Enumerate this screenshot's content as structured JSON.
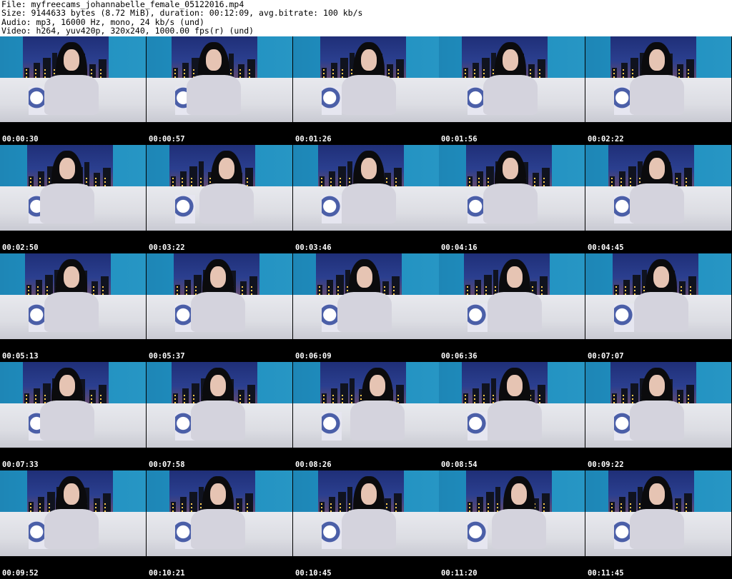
{
  "header": {
    "lines": [
      "File: myfreecams_johannabelle_female_05122016.mp4",
      "Size: 9144633 bytes (8.72 MiB), duration: 00:12:09, avg.bitrate: 100 kb/s",
      "Audio: mp3, 16000 Hz, mono, 24 kb/s (und)",
      "Video: h264, yuv420p, 320x240, 1000.00 fps(r) (und)"
    ]
  },
  "thumbnails": [
    {
      "timestamp": "00:00:30"
    },
    {
      "timestamp": "00:00:57"
    },
    {
      "timestamp": "00:01:26"
    },
    {
      "timestamp": "00:01:56"
    },
    {
      "timestamp": "00:02:22"
    },
    {
      "timestamp": "00:02:50"
    },
    {
      "timestamp": "00:03:22"
    },
    {
      "timestamp": "00:03:46"
    },
    {
      "timestamp": "00:04:16"
    },
    {
      "timestamp": "00:04:45"
    },
    {
      "timestamp": "00:05:13"
    },
    {
      "timestamp": "00:05:37"
    },
    {
      "timestamp": "00:06:09"
    },
    {
      "timestamp": "00:06:36"
    },
    {
      "timestamp": "00:07:07"
    },
    {
      "timestamp": "00:07:33"
    },
    {
      "timestamp": "00:07:58"
    },
    {
      "timestamp": "00:08:26"
    },
    {
      "timestamp": "00:08:54"
    },
    {
      "timestamp": "00:09:22"
    },
    {
      "timestamp": "00:09:52"
    },
    {
      "timestamp": "00:10:21"
    },
    {
      "timestamp": "00:10:45"
    },
    {
      "timestamp": "00:11:20"
    },
    {
      "timestamp": "00:11:45"
    }
  ],
  "colors": {
    "wall": "#1f8fc0",
    "skyline_sky": "#2b3f8f",
    "couch": "#dcdde3",
    "background": "#000000",
    "text": "#ffffff"
  }
}
